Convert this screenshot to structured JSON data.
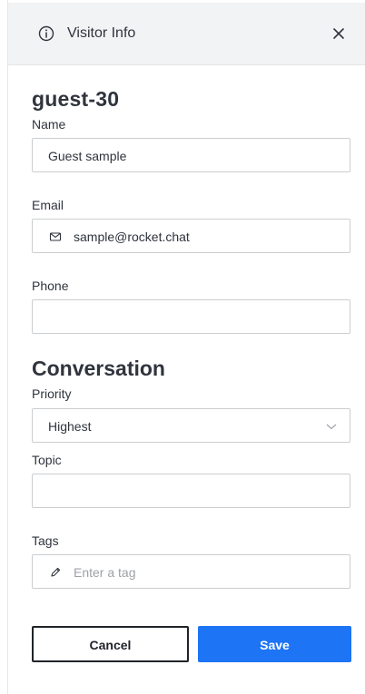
{
  "header": {
    "title": "Visitor Info",
    "icon": "info-icon",
    "close_icon": "close-icon"
  },
  "visitor": {
    "username": "guest-30"
  },
  "fields": {
    "name": {
      "label": "Name",
      "value": "Guest sample"
    },
    "email": {
      "label": "Email",
      "value": "sample@rocket.chat",
      "icon": "mail-icon"
    },
    "phone": {
      "label": "Phone",
      "value": ""
    }
  },
  "conversation": {
    "title": "Conversation",
    "priority": {
      "label": "Priority",
      "value": "Highest"
    },
    "topic": {
      "label": "Topic",
      "value": ""
    },
    "tags": {
      "label": "Tags",
      "placeholder": "Enter a tag",
      "icon": "pencil-icon"
    }
  },
  "actions": {
    "cancel_label": "Cancel",
    "save_label": "Save"
  },
  "colors": {
    "primary": "#1d74f5",
    "header_bg": "#f2f3f5",
    "border": "#cbced1",
    "text": "#2f343d",
    "placeholder": "#9ea2a8"
  }
}
